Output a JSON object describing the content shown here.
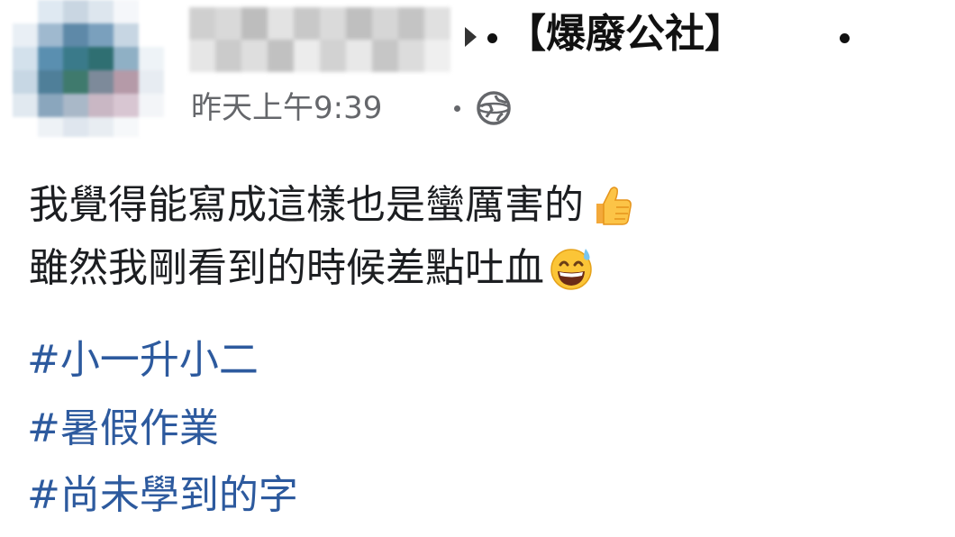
{
  "post": {
    "group_name": "【爆廢公社】",
    "timestamp": "昨天上午9:39",
    "audience_icon": "globe-icon",
    "body_lines": [
      "我覺得能寫成這樣也是蠻厲害的",
      "雖然我剛看到的時候差點吐血"
    ],
    "emojis": [
      "thumbs-up-emoji",
      "grinning-sweat-emoji"
    ],
    "hashtags": [
      "#小一升小二",
      "#暑假作業",
      "#尚未學到的字"
    ]
  },
  "colors": {
    "hashtag": "#2d5a9e",
    "text": "#1c1e21",
    "meta": "#65676b"
  }
}
